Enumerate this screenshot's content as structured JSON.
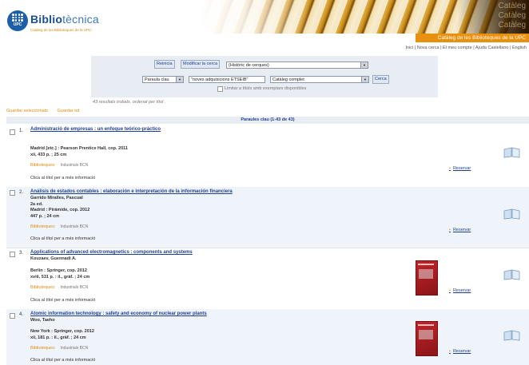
{
  "header": {
    "brand_bold": "Biblio",
    "brand_light": "tècnica",
    "subtitle": "Catàleg de les Biblioteques de la UPC",
    "logo_text": "UPC",
    "banner_ghost": [
      "Catàleg",
      "Catàleg",
      "Catàleg"
    ],
    "orange_bar": "Catàleg de les Biblioteques de la UPC"
  },
  "topnav": "Inici | Nova cerca | El meu compte | Ajuda   Castellano | English",
  "search": {
    "reinicia": "Reinicia",
    "modifica": "Modificar la cerca",
    "history": "(Històric de cerques)",
    "field": "Paraula clau",
    "query": "\"noves adquisicions ETSEIB\"",
    "scope": "Catàleg complet",
    "button": "Cerca",
    "limit": "Limitar a títols amb exemplars disponibles",
    "results_info": "43 resultats trobats. ordenat per títol ."
  },
  "actions": {
    "save_selected": "Guardar seleccionats",
    "save_all": "Guardar tot"
  },
  "results_header": "Paraules clau (1-43 de 43)",
  "labels": {
    "bib_label": "Biblioteques:",
    "click_info": "Clica al títol per a més informació",
    "reserve": "Reservar",
    "bullet": "•"
  },
  "records": [
    {
      "num": "1.",
      "title": "Administració de empresas : un enfoque teórico-práctico",
      "author": "",
      "edition": "",
      "pub": "Madrid [etc.] : Pearson Prentice Hall, cop. 2011",
      "desc": "xii, 433 p. ; 25 cm",
      "library": "Industrials BCN"
    },
    {
      "num": "2.",
      "title": "Análisis de estados contables : elaboración e interpretación de la información financiera",
      "author": "Garrido Miralles, Pascual",
      "edition": "2a ed.",
      "pub": "Madrid : Pirámide, cop. 2012",
      "desc": "447 p. ; 24 cm",
      "library": "Industrials BCN"
    },
    {
      "num": "3.",
      "title": "Applications of advanced electromagnetics : components and systems",
      "author": "Kouzaev, Guennadi A.",
      "edition": "",
      "pub": "Berlin : Springer, cop. 2012",
      "desc": "xviii, 531 p. : il., gràf. ; 24 cm",
      "library": "Industrials BCN"
    },
    {
      "num": "4.",
      "title": "Atomic information technology : safety and economy of nuclear power plants",
      "author": "Woo, Taeho",
      "edition": "",
      "pub": "New York : Springer, cop. 2012",
      "desc": "xii, 181 p. : il., gràf. ; 24 cm",
      "library": "Industrials BCN"
    }
  ]
}
